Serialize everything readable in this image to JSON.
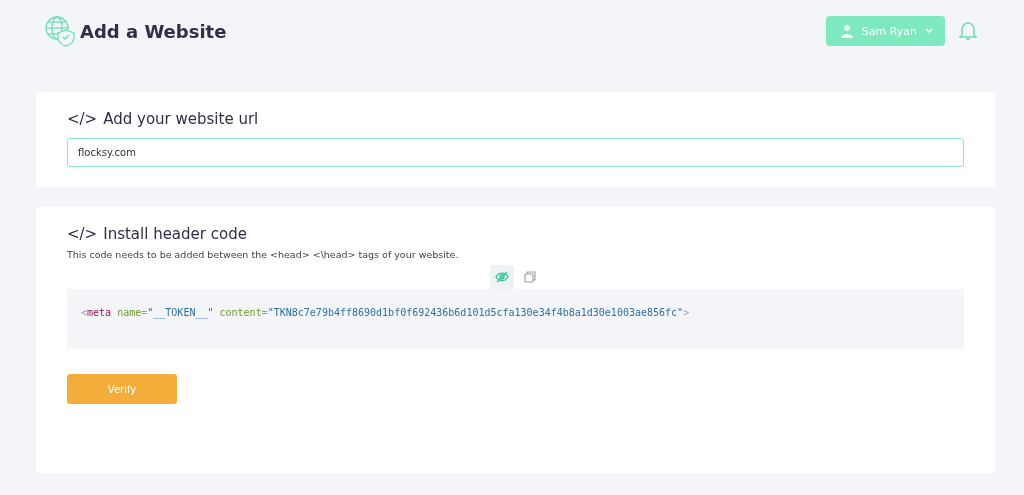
{
  "header": {
    "title": "Add a Website",
    "user": {
      "name": "Sam Ryan"
    }
  },
  "url_card": {
    "icon": "</>",
    "title": "Add your website url",
    "url": "flocksy.com"
  },
  "install_card": {
    "icon": "</>",
    "title": "Install header code",
    "description": "This code needs to be added between the <head> <\\head> tags of your website.",
    "code": [
      {
        "kind": "punct",
        "text": "<"
      },
      {
        "kind": "tag",
        "text": "meta"
      },
      {
        "kind": "attr",
        "text": " name"
      },
      {
        "kind": "punct",
        "text": "="
      },
      {
        "kind": "string",
        "text": "\"__TOKEN__\""
      },
      {
        "kind": "attr",
        "text": " content"
      },
      {
        "kind": "punct",
        "text": "="
      },
      {
        "kind": "string",
        "text": "\"TKN8c7e79b4ff8690d1bf0f692436b6d101d5cfa130e34f4b8a1d30e1003ae856fc\""
      },
      {
        "kind": "punct",
        "text": ">"
      }
    ],
    "button": "Verify"
  }
}
